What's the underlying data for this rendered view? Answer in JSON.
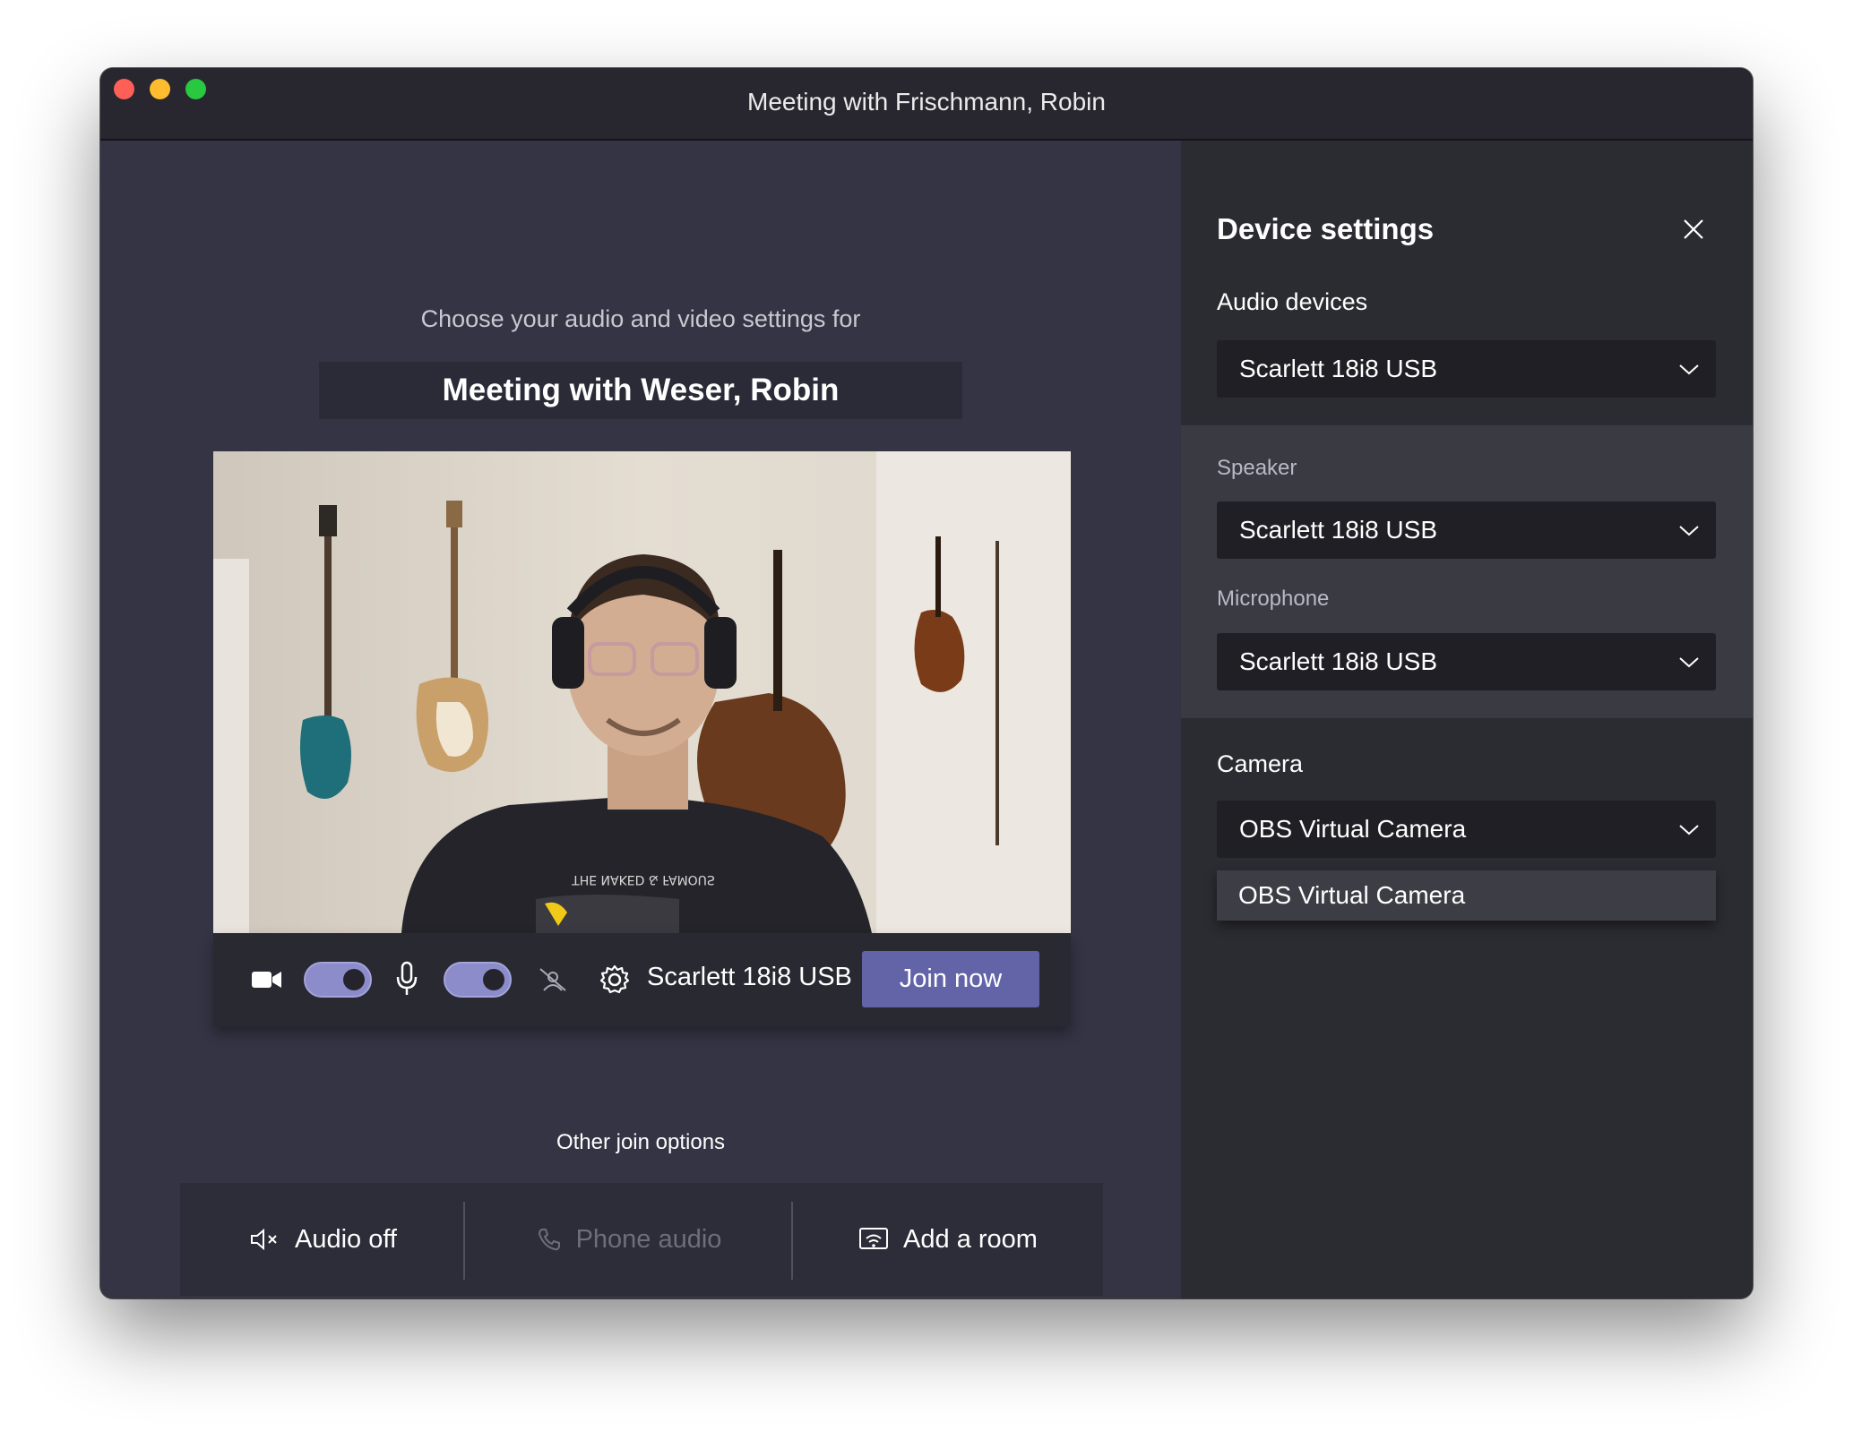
{
  "window": {
    "title": "Meeting with Frischmann, Robin"
  },
  "prejoin": {
    "subtitle": "Choose your audio and video settings for",
    "meeting_title": "Meeting with Weser, Robin",
    "video_preview": {
      "shirt_text": "THE NAKED & FAMOUS"
    },
    "controls": {
      "camera_on": true,
      "mic_on": true,
      "device_label": "Scarlett 18i8 USB",
      "join_label": "Join now"
    },
    "other_options": {
      "heading": "Other join options",
      "items": [
        {
          "label": "Audio off",
          "icon": "speaker-off-icon",
          "enabled": true
        },
        {
          "label": "Phone audio",
          "icon": "phone-icon",
          "enabled": false
        },
        {
          "label": "Add a room",
          "icon": "cast-room-icon",
          "enabled": true
        }
      ]
    }
  },
  "device_settings": {
    "title": "Device settings",
    "audio_devices_label": "Audio devices",
    "audio_devices_value": "Scarlett 18i8 USB",
    "speaker_label": "Speaker",
    "speaker_value": "Scarlett 18i8 USB",
    "microphone_label": "Microphone",
    "microphone_value": "Scarlett 18i8 USB",
    "camera_label": "Camera",
    "camera_value": "OBS Virtual Camera",
    "camera_options": [
      "OBS Virtual Camera"
    ]
  },
  "colors": {
    "accent": "#6264a7",
    "toggle": "#8b8cc9"
  }
}
